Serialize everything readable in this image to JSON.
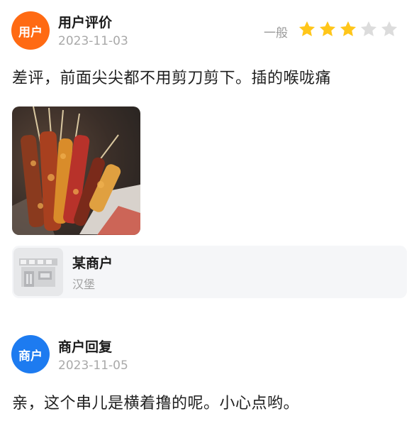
{
  "review": {
    "avatar_text": "用户",
    "author": "用户评价",
    "date": "2023-11-03",
    "rating_label": "一般",
    "rating": 3,
    "rating_max": 5,
    "text": "差评，前面尖尖都不用剪刀剪下。插的喉咙痛"
  },
  "shop": {
    "name": "某商户",
    "category": "汉堡"
  },
  "reply": {
    "avatar_text": "商户",
    "author": "商户回复",
    "date": "2023-11-05",
    "text": "亲，这个串儿是横着撸的呢。小心点哟。"
  },
  "colors": {
    "user_avatar": "#ff6a13",
    "merchant_avatar": "#1d7bf0",
    "star_on": "#ffc61a",
    "star_off": "#dcdcdc"
  }
}
